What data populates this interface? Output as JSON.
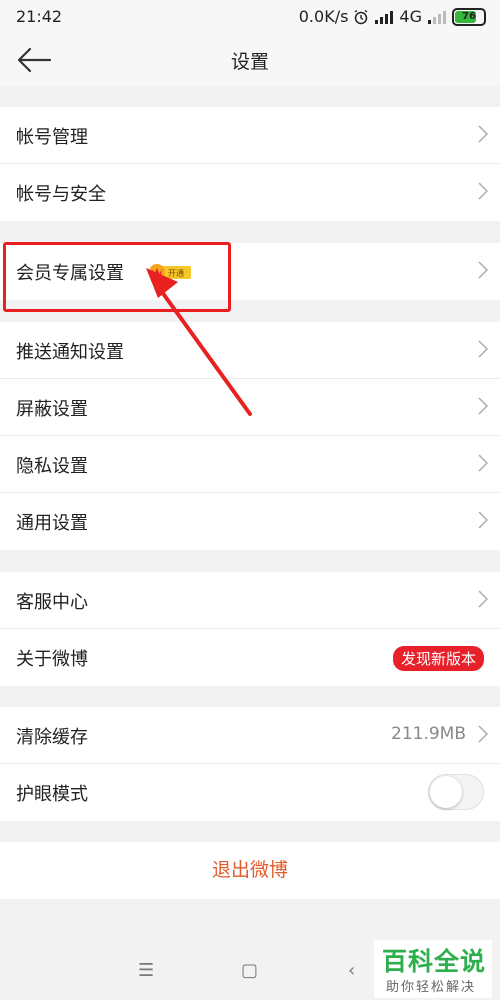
{
  "status": {
    "time": "21:42",
    "speed": "0.0K/s",
    "network": "4G",
    "battery": "76",
    "battery_fraction": 0.76
  },
  "nav": {
    "title": "设置"
  },
  "groups": [
    {
      "items": [
        {
          "label": "帐号管理"
        },
        {
          "label": "帐号与安全"
        }
      ]
    },
    {
      "items": [
        {
          "label": "会员专属设置",
          "badge": "开通"
        }
      ]
    },
    {
      "items": [
        {
          "label": "推送通知设置"
        },
        {
          "label": "屏蔽设置"
        },
        {
          "label": "隐私设置"
        },
        {
          "label": "通用设置"
        }
      ]
    },
    {
      "items": [
        {
          "label": "客服中心"
        },
        {
          "label": "关于微博",
          "badge": "发现新版本"
        }
      ]
    },
    {
      "items": [
        {
          "label": "清除缓存",
          "value": "211.9MB"
        },
        {
          "label": "护眼模式",
          "toggle": false
        }
      ]
    }
  ],
  "logout": {
    "label": "退出微博"
  },
  "watermark": {
    "main": "百科全说",
    "sub": "助你轻松解决"
  },
  "colors": {
    "accent_red": "#e8202a",
    "logout": "#e35b2a",
    "watermark_green": "#2eaf4e"
  }
}
